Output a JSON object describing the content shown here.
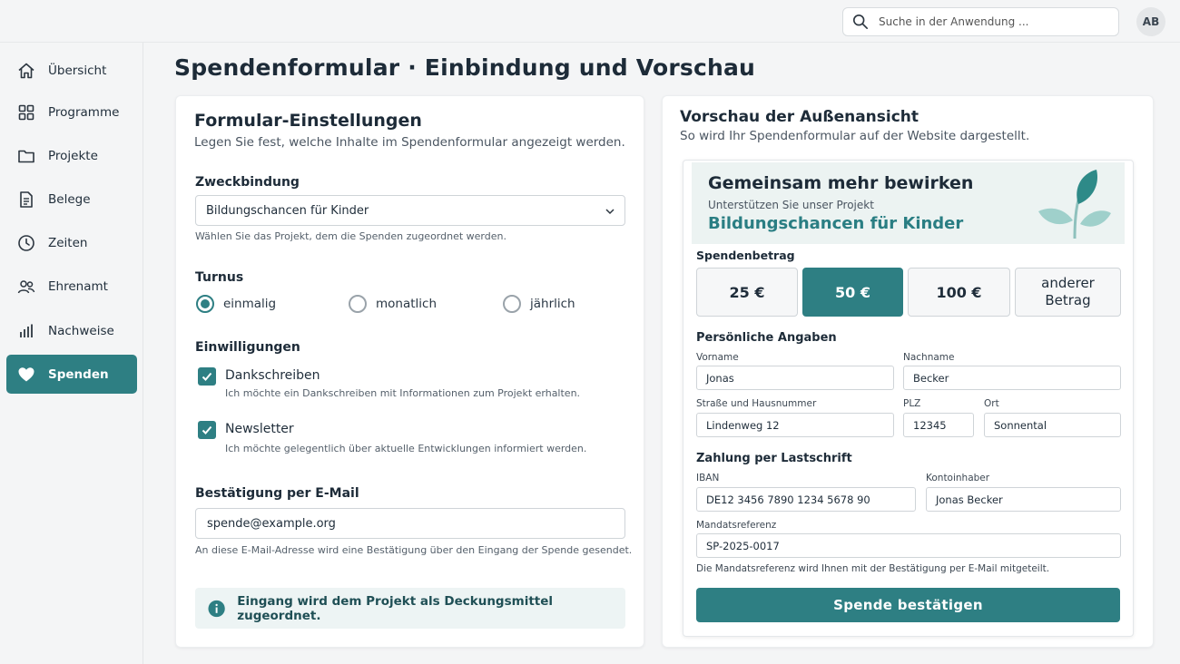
{
  "header": {
    "search_placeholder": "Suche in der Anwendung ...",
    "avatar_initials": "AB"
  },
  "sidebar": {
    "items": [
      {
        "label": "Übersicht",
        "icon": "home-icon"
      },
      {
        "label": "Programme",
        "icon": "grid-icon"
      },
      {
        "label": "Projekte",
        "icon": "folder-icon"
      },
      {
        "label": "Belege",
        "icon": "document-icon"
      },
      {
        "label": "Zeiten",
        "icon": "clock-icon"
      },
      {
        "label": "Ehrenamt",
        "icon": "people-icon"
      },
      {
        "label": "Nachweise",
        "icon": "bar-chart-icon"
      },
      {
        "label": "Spenden",
        "icon": "heart-icon",
        "active": true
      }
    ]
  },
  "page": {
    "title": "Spendenformular · Einbindung und Vorschau"
  },
  "settings": {
    "title": "Formular-Einstellungen",
    "subtitle": "Legen Sie fest, welche Inhalte im Spendenformular angezeigt werden.",
    "purpose": {
      "label": "Zweckbindung",
      "value": "Bildungschancen für Kinder",
      "hint": "Wählen Sie das Projekt, dem die Spenden zugeordnet werden."
    },
    "interval": {
      "label": "Turnus",
      "options": [
        "einmalig",
        "monatlich",
        "jährlich"
      ],
      "selected": "einmalig"
    },
    "consents": {
      "label": "Einwilligungen",
      "items": [
        {
          "label": "Dankschreiben",
          "hint": "Ich möchte ein Dankschreiben mit Informationen zum Projekt erhalten.",
          "checked": true
        },
        {
          "label": "Newsletter",
          "hint": "Ich möchte gelegentlich über aktuelle Entwicklungen informiert werden.",
          "checked": true
        }
      ]
    },
    "email": {
      "label": "Bestätigung per E-Mail",
      "value": "spende@example.org",
      "hint": "An diese E-Mail-Adresse wird eine Bestätigung über den Eingang der Spende gesendet."
    },
    "info": "Eingang wird dem Projekt als Deckungsmittel zugeordnet."
  },
  "preview": {
    "title": "Vorschau der Außenansicht",
    "subtitle": "So wird Ihr Spendenformular auf der Website dargestellt.",
    "hero": {
      "title": "Gemeinsam mehr bewirken",
      "subtitle": "Unterstützen Sie unser Projekt",
      "project": "Bildungschancen für Kinder"
    },
    "amount": {
      "label": "Spendenbetrag",
      "options": [
        "25 €",
        "50 €",
        "100 €",
        "anderer Betrag"
      ],
      "selected": "50 €"
    },
    "personal": {
      "label": "Persönliche Angaben",
      "firstname_label": "Vorname",
      "firstname": "Jonas",
      "lastname_label": "Nachname",
      "lastname": "Becker",
      "street_label": "Straße und Hausnummer",
      "street": "Lindenweg 12",
      "zip_label": "PLZ",
      "zip": "12345",
      "city_label": "Ort",
      "city": "Sonnental"
    },
    "payment": {
      "label": "Zahlung per Lastschrift",
      "iban_label": "IBAN",
      "iban": "DE12 3456 7890 1234 5678 90",
      "holder_label": "Kontoinhaber",
      "holder": "Jonas Becker",
      "mandate_label": "Mandatsreferenz",
      "mandate": "SP-2025-0017",
      "mandate_hint": "Die Mandatsreferenz wird Ihnen mit der Bestätigung per E-Mail mitgeteilt."
    },
    "submit": "Spende bestätigen"
  },
  "colors": {
    "accent": "#2e7f83",
    "info_bg": "#edf4f4",
    "hero_bg": "#ecf3f2"
  }
}
